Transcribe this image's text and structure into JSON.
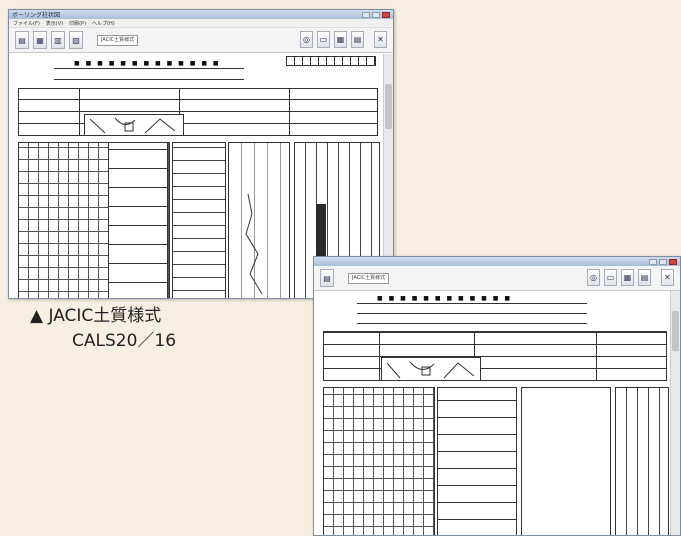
{
  "caption": {
    "marker": "▲",
    "line1": "JACIC土質様式",
    "line2": "CALS20／16"
  },
  "back_window": {
    "title": "ボーリング柱状図",
    "menus": [
      "ファイル(F)",
      "表示(V)",
      "印刷(P)",
      "ヘルプ(H)"
    ],
    "toolbar_field": "JACIC土質様式"
  },
  "front_window": {
    "toolbar_field": "JACIC土質様式"
  },
  "colors": {
    "background": "#f7efe1",
    "window_border": "#7d8fa6",
    "titlebar": "#a9bfd9"
  },
  "icons": [
    "open-icon",
    "save-icon",
    "print-icon",
    "preview-icon",
    "zoom-icon",
    "close-icon"
  ]
}
